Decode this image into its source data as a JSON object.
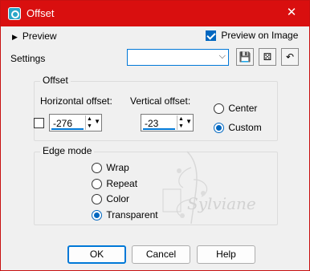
{
  "window": {
    "title": "Offset",
    "close_glyph": "✕"
  },
  "preview": {
    "label": "Preview",
    "on_image_label": "Preview on Image",
    "on_image_checked": true
  },
  "settings": {
    "label": "Settings",
    "preset_value": ""
  },
  "offset": {
    "group_label": "Offset",
    "horizontal_label": "Horizontal offset:",
    "horizontal_value": "-276",
    "vertical_label": "Vertical offset:",
    "vertical_value": "-23",
    "center_label": "Center",
    "custom_label": "Custom",
    "selected": "Custom"
  },
  "edge_mode": {
    "group_label": "Edge mode",
    "options": [
      "Wrap",
      "Repeat",
      "Color",
      "Transparent"
    ],
    "selected": "Transparent"
  },
  "buttons": {
    "ok": "OK",
    "cancel": "Cancel",
    "help": "Help"
  },
  "watermark": {
    "text": "Sylviane"
  },
  "colors": {
    "titlebar": "#d90f0f",
    "accent": "#0067c0"
  }
}
